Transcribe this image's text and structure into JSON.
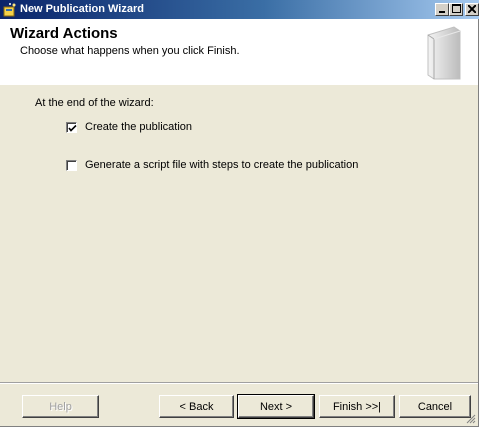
{
  "window": {
    "title": "New Publication Wizard",
    "icon": "wizard-icon",
    "controls": {
      "minimize": "minimize-icon",
      "maximize": "maximize-icon",
      "close": "close-icon"
    }
  },
  "header": {
    "title": "Wizard Actions",
    "subtitle": "Choose what happens when you click Finish."
  },
  "body": {
    "prompt": "At the end of the wizard:",
    "options": [
      {
        "label": "Create the publication",
        "checked": true
      },
      {
        "label": "Generate a script file with steps to create the publication",
        "checked": false
      }
    ]
  },
  "buttons": {
    "help": "Help",
    "back": "< Back",
    "next": "Next >",
    "finish": "Finish >>|",
    "cancel": "Cancel"
  },
  "colors": {
    "titlebar_start": "#0a246a",
    "titlebar_end": "#a6caf0",
    "dialog_bg": "#ece9d8",
    "header_bg": "#ffffff"
  }
}
